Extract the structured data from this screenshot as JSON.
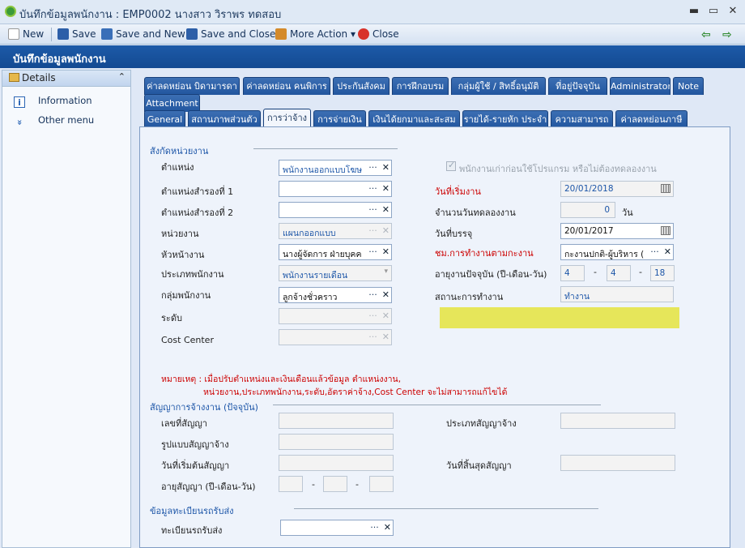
{
  "window": {
    "title": "บันทึกข้อมูลพนักงาน : EMP0002 นางสาว วิราพร ทดสอบ",
    "minimize": "▬",
    "restore": "▭",
    "close": "✕"
  },
  "toolbar": {
    "new": "New",
    "save": "Save",
    "save_new": "Save and New",
    "save_close": "Save and Close",
    "more": "More Action",
    "more_arrow": "▾",
    "close": "Close",
    "back": "⇦",
    "forward": "⇨"
  },
  "header": {
    "title": "บันทึกข้อมูลพนักงาน"
  },
  "sidebar": {
    "title": "Details",
    "collapse": "⌃",
    "items": [
      {
        "label": "Information",
        "icon": "info-icon",
        "glyph": "i"
      },
      {
        "label": "Other menu",
        "icon": "double-chevron-down-icon",
        "glyph": "»"
      }
    ]
  },
  "tabs_row1": [
    "ค่าลดหย่อน บิดามารดา",
    "ค่าลดหย่อน คนพิการ",
    "ประกันสังคม",
    "การฝึกอบรม",
    "กลุ่มผู้ใช้ / สิทธิ์อนุมัติ",
    "ที่อยู่ปัจจุบัน",
    "Administrator",
    "Note"
  ],
  "tabs_row2": [
    "Attachment"
  ],
  "tabs_row3": [
    "General",
    "สถานภาพส่วนตัว",
    "การว่าจ้าง",
    "การจ่ายเงิน",
    "เงินได้ยกมาและสะสม",
    "รายได้-รายหัก ประจำ",
    "ความสามารถ",
    "ค่าลดหย่อนภาษี"
  ],
  "active_tab": "การว่าจ้าง",
  "form": {
    "section_unit": "สังกัดหน่วยงาน",
    "position": {
      "label": "ตำแหน่ง",
      "value": "พนักงานออกแบบโฆษ"
    },
    "position2": {
      "label": "ตำแหน่งสำรองที่ 1",
      "value": ""
    },
    "position3": {
      "label": "ตำแหน่งสำรองที่ 2",
      "value": ""
    },
    "department": {
      "label": "หน่วยงาน",
      "value": "แผนกออกแบบ"
    },
    "supervisor": {
      "label": "หัวหน้างาน",
      "value": "นางผู้จัดการ ฝ่ายบุคค"
    },
    "emp_type": {
      "label": "ประเภทพนักงาน",
      "value": "พนักงานรายเดือน"
    },
    "emp_group": {
      "label": "กลุ่มพนักงาน",
      "value": "ลูกจ้างชั่วคราว"
    },
    "level": {
      "label": "ระดับ",
      "value": ""
    },
    "cost_center": {
      "label": "Cost Center",
      "value": ""
    },
    "ellipsis": "···",
    "clear": "✕",
    "dropdown": "▾",
    "old_employee": {
      "label": "พนักงานเก่าก่อนใช้โปรแกรม หรือไม่ต้องทดลองงาน",
      "checked": true
    },
    "start_date": {
      "label": "วันที่เริ่มงาน",
      "value": "20/01/2018"
    },
    "probation": {
      "label": "จำนวนวันทดลองงาน",
      "value": "0",
      "unit": "วัน"
    },
    "confirm_date": {
      "label": "วันที่บรรจุ",
      "value": "20/01/2017"
    },
    "workhours": {
      "label": "ชม.การทำงานตามกะงาน",
      "value": "กะงานปกติ-ผู้บริหาร ("
    },
    "tenure": {
      "label": "อายุงานปัจจุบัน (ปี-เดือน-วัน)",
      "y": "4",
      "m": "4",
      "d": "18",
      "dash": "-"
    },
    "work_status": {
      "label": "สถานะการทำงาน",
      "value": "ทำงาน"
    },
    "note_line1": "หมายเหตุ : เมื่อปรับตำแหน่งและเงินเดือนแล้วข้อมูล ตำแหน่งงาน,",
    "note_line2": "หน่วยงาน,ประเภทพนักงาน,ระดับ,อัตราค่าจ้าง,Cost Center  จะไม่สามารถแก้ไขได้",
    "section_contract": "สัญญาการจ้างงาน (ปัจจุบัน)",
    "contract_no": {
      "label": "เลขที่สัญญา",
      "value": ""
    },
    "contract_type": {
      "label": "ประเภทสัญญาจ้าง",
      "value": ""
    },
    "contract_form": {
      "label": "รูปแบบสัญญาจ้าง",
      "value": ""
    },
    "contract_start": {
      "label": "วันที่เริ่มต้นสัญญา",
      "value": ""
    },
    "contract_end": {
      "label": "วันที่สิ้นสุดสัญญา",
      "value": ""
    },
    "contract_age": {
      "label": "อายุสัญญา (ปี-เดือน-วัน)"
    },
    "section_vehicle": "ข้อมูลทะเบียนรถรับส่ง",
    "vehicle": {
      "label": "ทะเบียนรถรับส่ง",
      "value": ""
    }
  }
}
